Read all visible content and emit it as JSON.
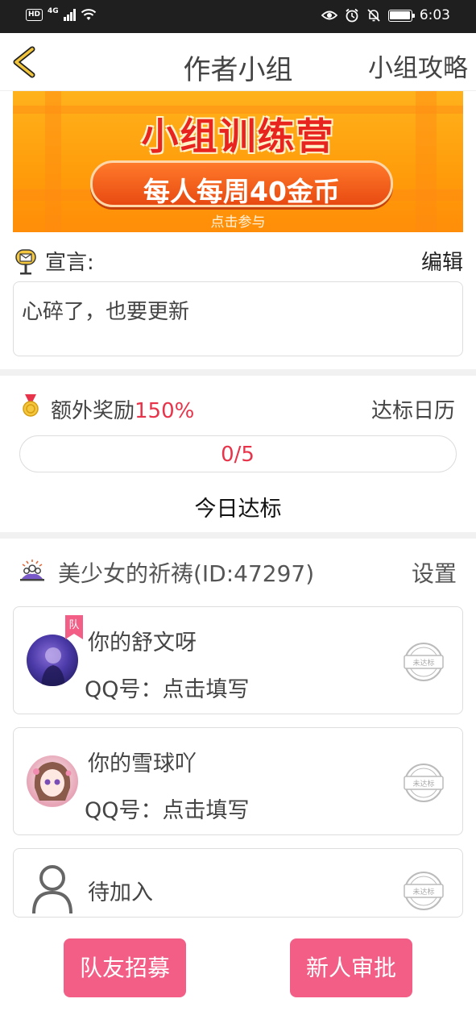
{
  "status_bar": {
    "hd": "HD",
    "network": "4G",
    "time": "6:03",
    "icons": [
      "eye-icon",
      "alarm-icon",
      "mute-icon",
      "battery-icon"
    ]
  },
  "nav": {
    "title": "作者小组",
    "right_label": "小组攻略",
    "back_icon": "chevron-left-icon",
    "accent": "#f2c53d"
  },
  "banner": {
    "title": "小组训练营",
    "pill": "每人每周40金币",
    "sub": "点击参与"
  },
  "declaration": {
    "label": "宣言:",
    "edit": "编辑",
    "text": "心碎了，也要更新"
  },
  "reward": {
    "label": "额外奖励",
    "percent": "150%",
    "calendar": "达标日历",
    "progress_text": "0/5",
    "progress_value": 0,
    "today": "今日达标"
  },
  "group": {
    "name": "美少女的祈祷(ID:47297)",
    "settings": "设置",
    "members": [
      {
        "name": "你的舒文呀",
        "qq": "QQ号：点击填写",
        "team_badge": "队",
        "stamp": "未达标"
      },
      {
        "name": "你的雪球吖",
        "qq": "QQ号：点击填写",
        "stamp": "未达标"
      }
    ],
    "pending": {
      "label": "待加入",
      "stamp": "未达标"
    }
  },
  "buttons": {
    "recruit": "队友招募",
    "approve": "新人审批"
  },
  "colors": {
    "pink": "#f25e86",
    "red": "#e8344a",
    "banner_orange": "#ff9c0a"
  }
}
